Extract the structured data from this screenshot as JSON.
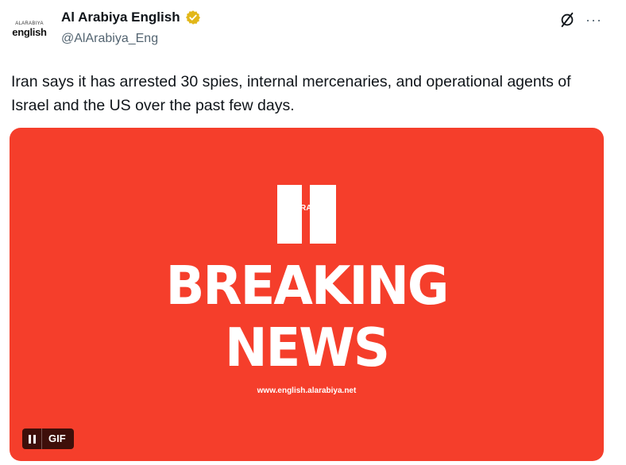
{
  "author": {
    "avatar_small_text": "ALARABIYA",
    "avatar_big_text": "english",
    "display_name": "Al Arabiya English",
    "handle": "@AlArabiya_Eng",
    "verified_badge_color": "#e2b719"
  },
  "actions": {
    "grok_icon": "grok-slash-circle-icon",
    "more_label": "···"
  },
  "tweet": {
    "text": "Iran says it has arrested 30 spies, internal mercenaries, and operational agents of Israel and the US over the past few days."
  },
  "media": {
    "background_color": "#f53e2b",
    "logo_letters": "RA",
    "headline_line1": "BREAKING",
    "headline_line2": "NEWS",
    "site_url": "www.english.alarabiya.net",
    "gif_label": "GIF",
    "pause_icon": "pause-icon"
  }
}
